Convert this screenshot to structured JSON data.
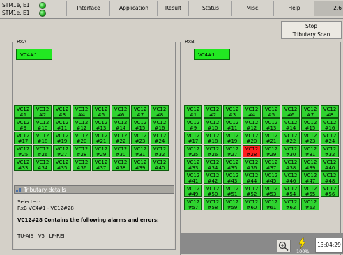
{
  "ports": [
    {
      "label": "STM1e, E1",
      "status": "ok"
    },
    {
      "label": "STM1e, E1",
      "status": "ok"
    }
  ],
  "tabs": [
    {
      "label": "Interface"
    },
    {
      "label": "Application"
    },
    {
      "label": "Result"
    },
    {
      "label": "Status"
    },
    {
      "label": "Misc."
    },
    {
      "label": "Help"
    },
    {
      "label": "2.6"
    }
  ],
  "stop_button": {
    "line1": "Stop",
    "line2": "Tributary Scan"
  },
  "panel_a": {
    "label": "RxA",
    "vc4": "VC4#1",
    "cells": [
      [
        "#1",
        "#2",
        "#3",
        "#4",
        "#5",
        "#6",
        "#7",
        "#8"
      ],
      [
        "#9",
        "#10",
        "#11",
        "#12",
        "#13",
        "#14",
        "#15",
        "#16"
      ],
      [
        "#17",
        "#18",
        "#19",
        "#20",
        "#21",
        "#22",
        "#23",
        "#24"
      ],
      [
        "#25",
        "#26",
        "#27",
        "#28",
        "#29",
        "#30",
        "#31",
        "#32"
      ],
      [
        "#33",
        "#34",
        "#35",
        "#36",
        "#37",
        "#38",
        "#39",
        "#40"
      ]
    ]
  },
  "panel_b": {
    "label": "RxB",
    "vc4": "VC4#1",
    "cells": [
      [
        "#1",
        "#2",
        "#3",
        "#4",
        "#5",
        "#6",
        "#7",
        "#8"
      ],
      [
        "#9",
        "#10",
        "#11",
        "#12",
        "#13",
        "#14",
        "#15",
        "#16"
      ],
      [
        "#17",
        "#18",
        "#19",
        "#20",
        "#21",
        "#22",
        "#23",
        "#24"
      ],
      [
        "#25",
        "#26",
        "#27",
        "#28",
        "#29",
        "#30",
        "#31",
        "#32"
      ],
      [
        "#33",
        "#34",
        "#35",
        "#36",
        "#37",
        "#38",
        "#39",
        "#40"
      ],
      [
        "#41",
        "#42",
        "#43",
        "#44",
        "#45",
        "#46",
        "#47",
        "#48"
      ],
      [
        "#49",
        "#50",
        "#51",
        "#52",
        "#53",
        "#54",
        "#55",
        "#56"
      ],
      [
        "#57",
        "#58",
        "#59",
        "#60",
        "#61",
        "#62",
        "#63"
      ]
    ],
    "selected_cell": "#28"
  },
  "cell_prefix": "VC12",
  "colors": {
    "ok": "#2fd32f",
    "alarm": "#ff1e1e"
  },
  "details": {
    "title": "Tributary details",
    "selected_label": "Selected:",
    "selected_value": "RxB VC4#1 - VC12#28",
    "alarm_heading": "VC12#28 Contains the following alarms and errors:",
    "alarms": "TU-AIS , V5 , LP-REI"
  },
  "status": {
    "zoom_icon": "magnifier-plus-icon",
    "power_icon": "lightning-icon",
    "power": "100%",
    "time": "13:04:29"
  }
}
